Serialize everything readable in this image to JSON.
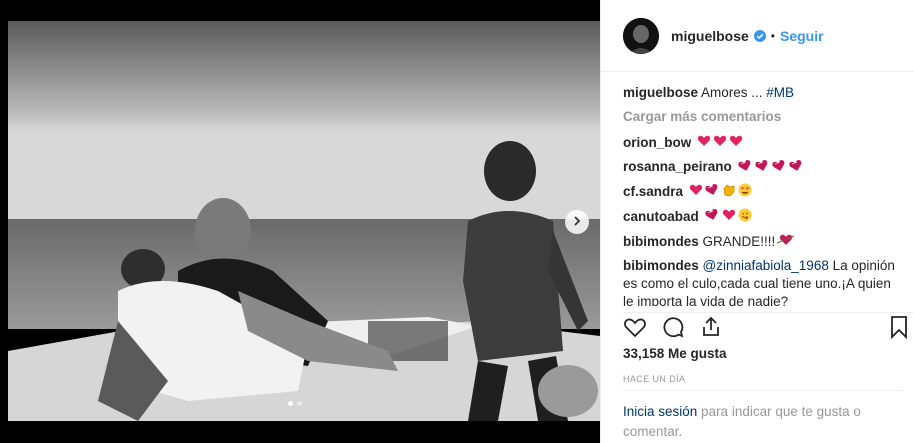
{
  "post": {
    "username": "miguelbose",
    "separator": "•",
    "follow_label": "Seguir",
    "caption_user": "miguelbose",
    "caption_text": "Amores ... ",
    "caption_tag": "#MB",
    "load_more": "Cargar más comentarios",
    "likes": "33,158 Me gusta",
    "time": "HACE UN DÍA",
    "login_link": "Inicia sesión",
    "login_text": " para indicar que te gusta o comentar."
  },
  "comments": [
    {
      "user": "orion_bow",
      "text": "",
      "emojis": [
        "heart",
        "heart",
        "heart"
      ]
    },
    {
      "user": "rosanna_peirano",
      "text": "",
      "emojis": [
        "heart-red-dark",
        "heart-red-dark",
        "heart-red-dark",
        "heart-red-dark"
      ]
    },
    {
      "user": "cf.sandra",
      "text": "",
      "emojis": [
        "heart",
        "heart-red-dark",
        "clapping-hands",
        "heart-eyes-face"
      ]
    },
    {
      "user": "canutoabad",
      "text": "",
      "emojis": [
        "heart-red-dark",
        "heart",
        "face-savoring"
      ]
    },
    {
      "user": "bibimondes",
      "text": "GRANDE!!!!",
      "emojis": [
        "heart-arrow"
      ]
    },
    {
      "user": "bibimondes",
      "mention": "@zinniafabiola_1968",
      "text": " La opinión es como el culo,cada cual tiene uno.¡A quien le importa la vida de nadie?",
      "emojis": []
    }
  ],
  "colors": {
    "link_blue": "#3897f0",
    "heart_red": "#e0245e",
    "text_dark": "#262626",
    "text_gray": "#999999"
  },
  "icons": {
    "verified": "verified-badge-icon",
    "like": "heart-outline-icon",
    "comment": "comment-bubble-icon",
    "share": "share-arrow-icon",
    "save": "bookmark-icon",
    "next": "chevron-right-icon"
  },
  "carousel": {
    "count": 2,
    "active": 0
  }
}
